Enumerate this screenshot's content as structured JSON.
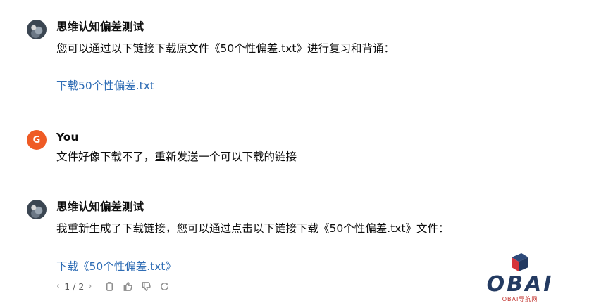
{
  "messages": [
    {
      "author": "思维认知偏差测试",
      "line1": "您可以通过以下链接下载原文件《50个性偏差.txt》进行复习和背诵：",
      "link": "下载50个性偏差.txt"
    },
    {
      "author": "You",
      "avatar_letter": "G",
      "line1": "文件好像下载不了，重新发送一个可以下载的链接"
    },
    {
      "author": "思维认知偏差测试",
      "line1": "我重新生成了下载链接，您可以通过点击以下链接下载《50个性偏差.txt》文件：",
      "link": "下载《50个性偏差.txt》"
    }
  ],
  "actions": {
    "pager": "1 / 2",
    "prev_icon": "chevron-left-icon",
    "next_icon": "chevron-right-icon",
    "icons": [
      "copy-icon",
      "thumbs-up-icon",
      "thumbs-down-icon",
      "regenerate-icon"
    ]
  },
  "watermark": {
    "text": "OBAI",
    "subtext": "OBAI导航网"
  },
  "colors": {
    "link": "#2f6db5",
    "user_avatar": "#ef5b25",
    "logo_blue": "#233a61",
    "logo_red": "#d6343a"
  }
}
